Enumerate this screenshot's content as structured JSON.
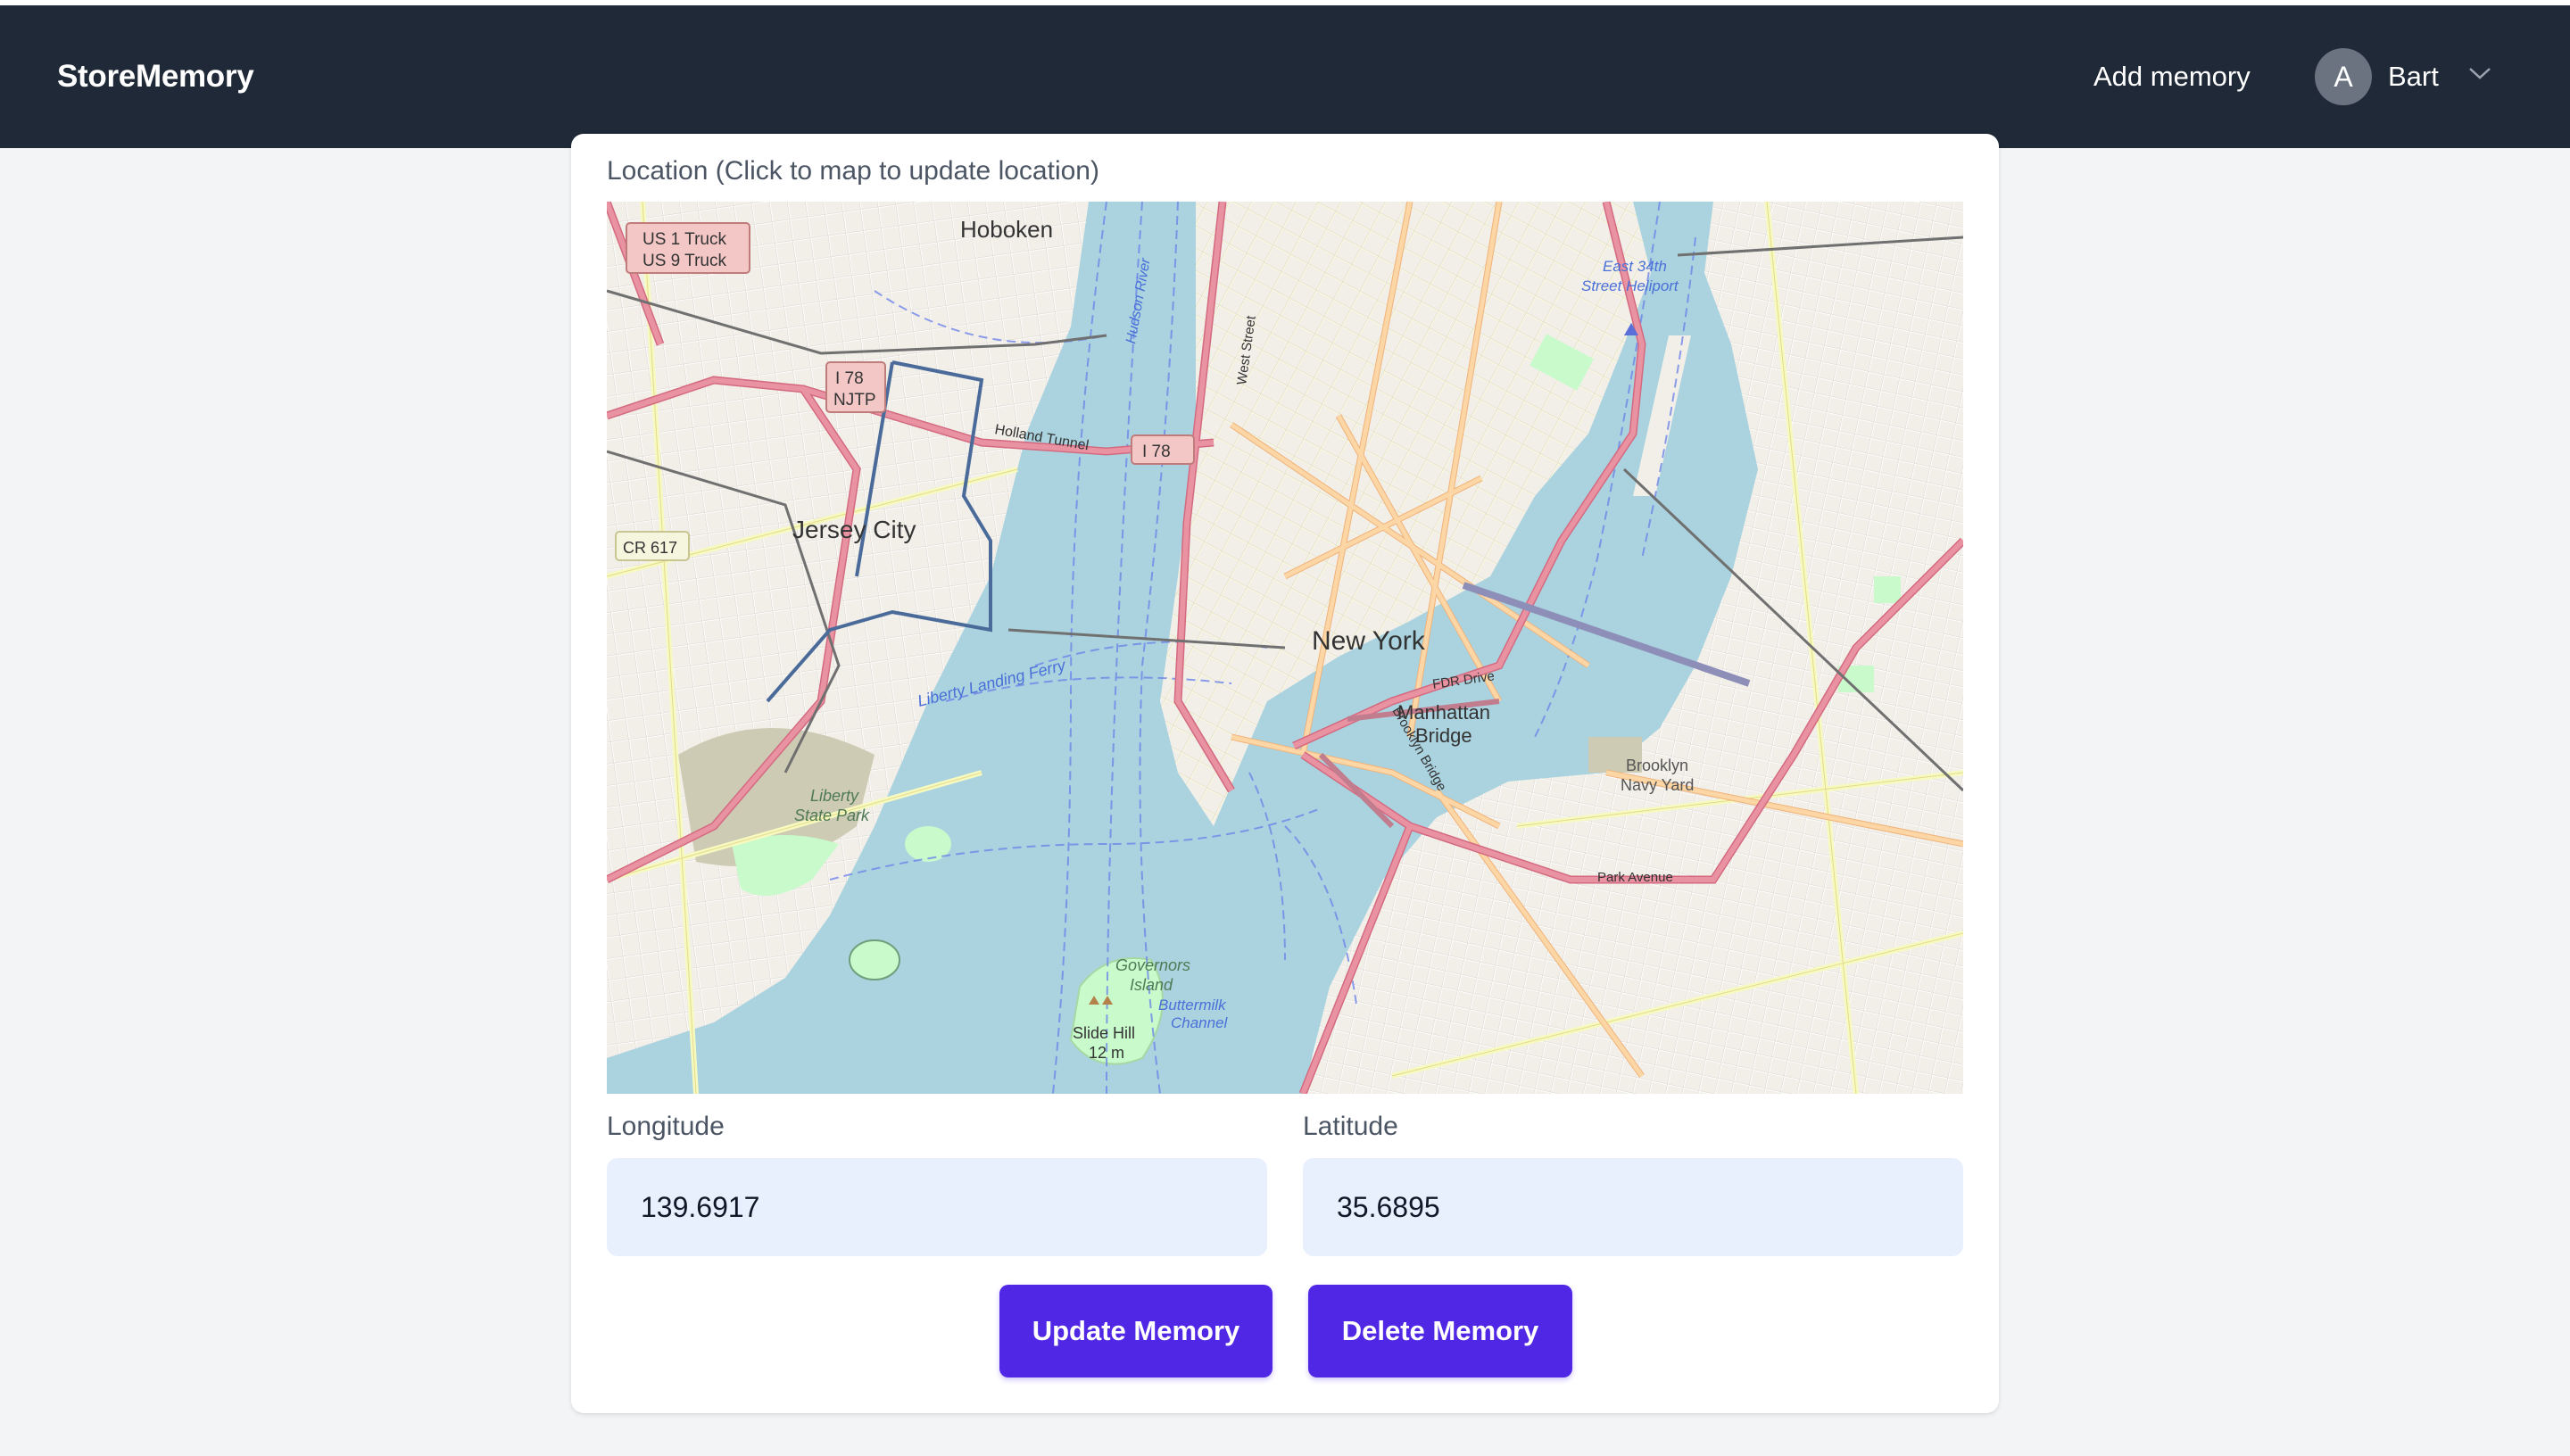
{
  "navbar": {
    "brand": "StoreMemory",
    "add_memory": "Add memory",
    "user": {
      "avatar_letter": "A",
      "name": "Bart",
      "menu_icon": "chevron-down-icon"
    }
  },
  "form": {
    "location_label": "Location (Click to map to update location)",
    "longitude_label": "Longitude",
    "longitude_value": "139.6917",
    "latitude_label": "Latitude",
    "latitude_value": "35.6895",
    "update_button": "Update Memory",
    "delete_button": "Delete Memory"
  },
  "map": {
    "places": {
      "new_york": "New York",
      "jersey_city": "Jersey City",
      "hoboken": "Hoboken",
      "manhattan_bridge_1": "Manhattan",
      "manhattan_bridge_2": "Bridge",
      "liberty_park_1": "Liberty",
      "liberty_park_2": "State Park",
      "governors_1": "Governors",
      "governors_2": "Island",
      "buttermilk_1": "Buttermilk",
      "buttermilk_2": "Channel",
      "slide_hill_1": "Slide Hill",
      "slide_hill_2": "12 m",
      "navy_yard_1": "Brooklyn",
      "navy_yard_2": "Navy Yard",
      "heliport_1": "East 34th",
      "heliport_2": "Street Heliport",
      "holland_tunnel": "Holland Tunnel",
      "liberty_landing": "Liberty Landing Ferry",
      "park_avenue": "Park Avenue",
      "fdr_drive": "FDR Drive",
      "west_street": "West Street",
      "brooklyn_bridge": "Brooklyn Bridge",
      "hudson_river": "Hudson River"
    },
    "shields": {
      "us1_1": "US 1 Truck",
      "us1_2": "US 9 Truck",
      "i78a_1": "I 78",
      "i78a_2": "NJTP",
      "i78b": "I 78",
      "cr617": "CR 617"
    },
    "colors": {
      "water": "#aad3df",
      "land": "#f2efe9",
      "park": "#c8facc",
      "motorway": "#e892a2",
      "primary": "#fcd6a4",
      "secondary": "#f7fabf"
    }
  }
}
